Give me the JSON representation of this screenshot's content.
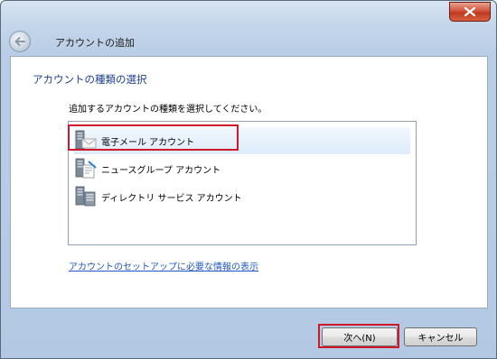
{
  "window": {
    "title": "アカウントの追加",
    "close_label": "✕"
  },
  "content": {
    "heading": "アカウントの種類の選択",
    "instruction": "追加するアカウントの種類を選択してください。",
    "account_types": [
      {
        "label": "電子メール アカウント",
        "icon": "email-server-icon",
        "selected": true
      },
      {
        "label": "ニュースグループ アカウント",
        "icon": "newsgroup-server-icon",
        "selected": false
      },
      {
        "label": "ディレクトリ サービス アカウント",
        "icon": "directory-server-icon",
        "selected": false
      }
    ],
    "info_link": "アカウントのセットアップに必要な情報の表示"
  },
  "buttons": {
    "next": "次へ(N)",
    "cancel": "キャンセル"
  },
  "colors": {
    "highlight": "#d3172a",
    "heading": "#1e3f8f",
    "link": "#1f57c5"
  }
}
